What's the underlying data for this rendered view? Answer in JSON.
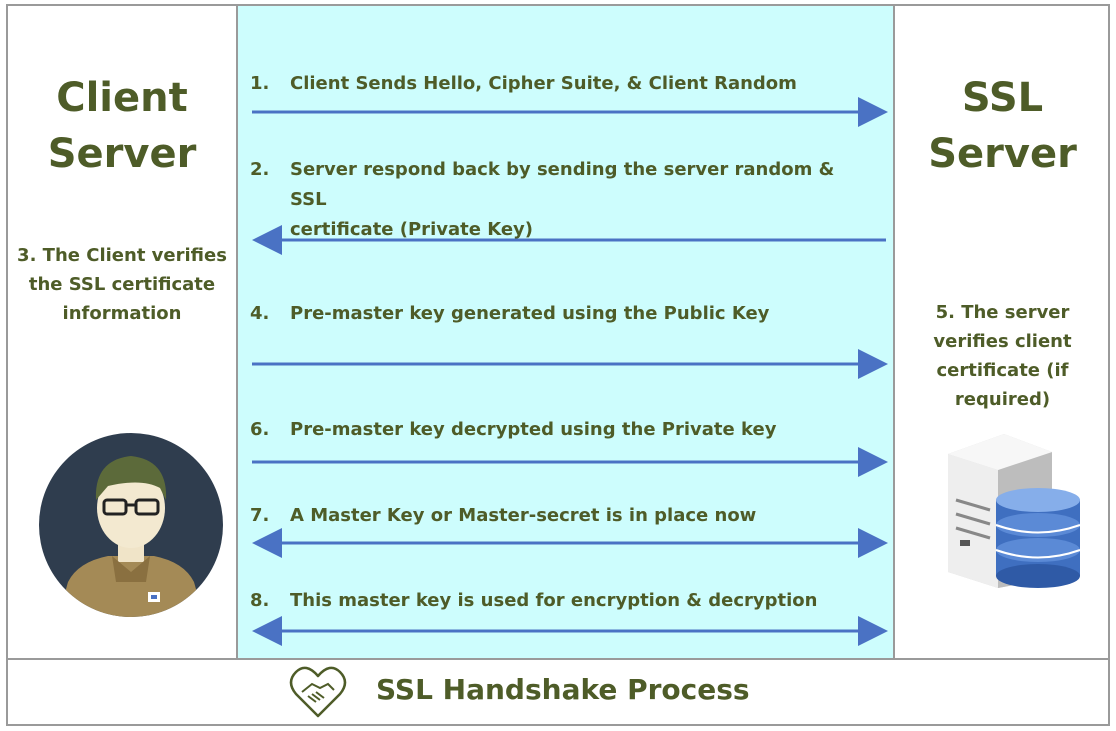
{
  "left_panel": {
    "title_line1": "Client",
    "title_line2": "Server",
    "note_line1": "3. The Client verifies",
    "note_line2": "the SSL certificate",
    "note_line3": "information",
    "avatar_icon": "user-avatar-icon"
  },
  "right_panel": {
    "title_line1": "SSL",
    "title_line2": "Server",
    "note_line1": "5. The server",
    "note_line2": "verifies client",
    "note_line3": "certificate (if",
    "note_line4": "required)",
    "server_icon": "database-server-icon"
  },
  "steps": [
    {
      "num": "1.",
      "line1": "Client Sends Hello, Cipher Suite, & Client Random",
      "line2": "",
      "direction": "right"
    },
    {
      "num": "2.",
      "line1": "Server respond back by sending the server random & SSL",
      "line2": "certificate (Private Key)",
      "direction": "left"
    },
    {
      "num": "4.",
      "line1": "Pre-master key generated using the Public Key",
      "line2": "",
      "direction": "right"
    },
    {
      "num": "6.",
      "line1": "Pre-master key decrypted using the Private key",
      "line2": "",
      "direction": "right"
    },
    {
      "num": "7.",
      "line1": "A Master Key or Master-secret is in place now",
      "line2": "",
      "direction": "both"
    },
    {
      "num": "8.",
      "line1": "This master key is used for encryption & decryption",
      "line2": "",
      "direction": "both"
    }
  ],
  "footer": {
    "title": "SSL Handshake Process",
    "icon": "handshake-heart-icon"
  },
  "colors": {
    "text": "#4e5c28",
    "arrow": "#4a72c4",
    "middle_bg": "#cdfdfd",
    "border": "#9a9a9a"
  }
}
